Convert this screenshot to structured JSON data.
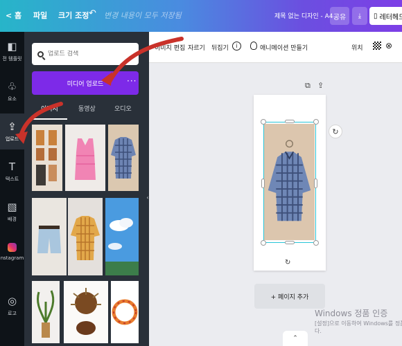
{
  "topbar": {
    "home": "홈",
    "file": "파일",
    "resize": "크기 조정",
    "undo_icon": "undo-icon",
    "save_status": "변경 내용이 모두 저장됨",
    "doc_title": "제목 없는 디자인 - A4",
    "share": "공유",
    "download_icon": "download-icon",
    "print_label": "레터헤드"
  },
  "rail": [
    {
      "icon": "templates-icon",
      "label": "전 템플릿"
    },
    {
      "icon": "elements-icon",
      "label": "요소"
    },
    {
      "icon": "upload-icon",
      "label": "업로드"
    },
    {
      "icon": "text-icon",
      "label": "텍스트"
    },
    {
      "icon": "background-icon",
      "label": "배경"
    },
    {
      "icon": "instagram-icon",
      "label": "nstagram"
    },
    {
      "icon": "logo-icon",
      "label": "로고"
    }
  ],
  "panel": {
    "search_placeholder": "업로드 검색",
    "upload_button": "미디어 업로드",
    "more": "···",
    "tabs": [
      {
        "label": "이미지"
      },
      {
        "label": "동영상"
      },
      {
        "label": "오디오"
      }
    ]
  },
  "toolbar": {
    "edit_image": "이미지 편집",
    "crop": "자르기",
    "flip": "뒤집기",
    "info": "i",
    "animate": "애니메이션 만들기",
    "position": "위치"
  },
  "canvas": {
    "rotate_icon": "↻",
    "add_page": "+ 페이지 추가"
  },
  "watermark": {
    "line1": "Windows 정품 인증",
    "line2": "[설정]으로 이동하여 Windows를 정품",
    "line3": "다."
  },
  "colors": {
    "accent_purple": "#7d2ae8",
    "selection_cyan": "#27c4d8",
    "arrow_red": "#c9322a"
  }
}
